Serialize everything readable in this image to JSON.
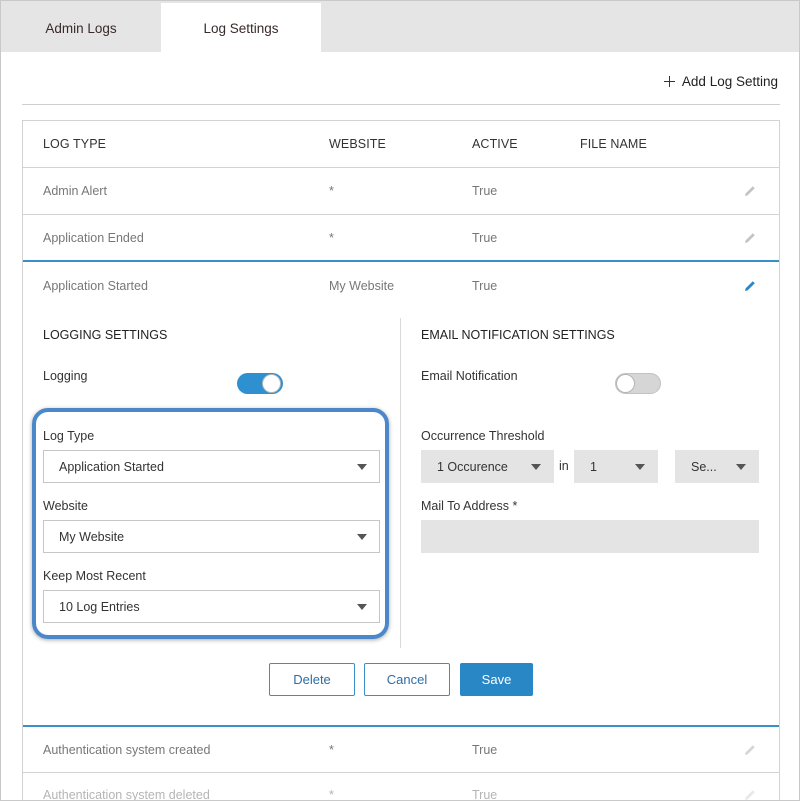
{
  "tabs": [
    {
      "label": "Admin Logs",
      "active": false
    },
    {
      "label": "Log Settings",
      "active": true
    }
  ],
  "toolbar": {
    "add_label": "Add Log Setting"
  },
  "table": {
    "headers": {
      "log_type": "LOG TYPE",
      "website": "WEBSITE",
      "active": "ACTIVE",
      "file_name": "FILE NAME"
    },
    "rows": [
      {
        "log_type": "Admin Alert",
        "website": "*",
        "active": "True",
        "file_name": ""
      },
      {
        "log_type": "Application Ended",
        "website": "*",
        "active": "True",
        "file_name": ""
      },
      {
        "log_type": "Application Started",
        "website": "My Website",
        "active": "True",
        "file_name": ""
      },
      {
        "log_type": "Authentication system created",
        "website": "*",
        "active": "True",
        "file_name": ""
      },
      {
        "log_type": "Authentication system deleted",
        "website": "*",
        "active": "True",
        "file_name": ""
      }
    ]
  },
  "logging": {
    "title": "LOGGING SETTINGS",
    "logging_label": "Logging",
    "logging_enabled": true,
    "log_type_label": "Log Type",
    "log_type_value": "Application Started",
    "website_label": "Website",
    "website_value": "My Website",
    "keep_label": "Keep Most Recent",
    "keep_value": "10 Log Entries"
  },
  "email": {
    "title": "EMAIL NOTIFICATION SETTINGS",
    "notification_label": "Email Notification",
    "notification_enabled": false,
    "threshold_label": "Occurrence Threshold",
    "threshold_count": "1 Occurence",
    "in_label": "in",
    "threshold_period": "1",
    "threshold_unit": "Se...",
    "mail_to_label": "Mail To Address *",
    "mail_to_value": ""
  },
  "actions": {
    "delete": "Delete",
    "cancel": "Cancel",
    "save": "Save"
  },
  "colors": {
    "accent": "#2a87c5",
    "highlight": "#4c88c9",
    "tab_bg": "#e5e5e5"
  }
}
